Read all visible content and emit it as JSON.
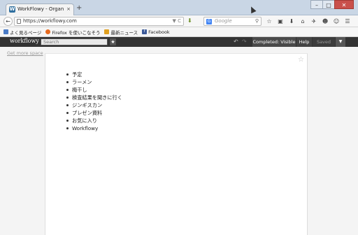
{
  "browser": {
    "tab_title": "WorkFlowy - Organize y...",
    "tab_favicon": "W",
    "tab_close": "×",
    "new_tab": "+",
    "url": "https://workflowy.com",
    "url_icons": "▼ C",
    "search_placeholder": "Google",
    "search_engine_icon": "G",
    "search_icon": "⚲",
    "back_icon": "←",
    "window_controls": {
      "minimize": "–",
      "maximize": "□",
      "close": "✕"
    },
    "tool_icons": [
      "☆",
      "▣",
      "⬇",
      "⌂",
      "✈",
      "☻",
      "☺",
      "☰"
    ]
  },
  "bookmarks": [
    {
      "label": "よく見るページ",
      "icon": "folder-icon",
      "color": "#4a7bc6"
    },
    {
      "label": "Firefox を使いこなそう",
      "icon": "firefox-icon",
      "color": "#e66a1e"
    },
    {
      "label": "最新ニュース",
      "icon": "rss-icon",
      "color": "#e0a020"
    },
    {
      "label": "Facebook",
      "icon": "facebook-icon",
      "color": "#3b5998"
    }
  ],
  "app": {
    "logo": "workflowy",
    "search_placeholder": "Search",
    "star_icon": "★",
    "undo_icon": "↶",
    "redo_icon": "↷",
    "completed_label": "Completed: Visible",
    "help_label": "Help",
    "saved_label": "Saved",
    "menu_icon": "▼",
    "get_more_space": "Get more space",
    "page_star_icon": "☆"
  },
  "outline": [
    "予定",
    "ラーメン",
    "梅干し",
    "検査結果を聞きに行く",
    "ジンギスカン",
    "プレゼン資料",
    "お気に入り",
    "Workflowy"
  ],
  "colors": {
    "appbar": "#333333",
    "titlebar": "#c9d6e5",
    "close_button": "#c9504b"
  }
}
